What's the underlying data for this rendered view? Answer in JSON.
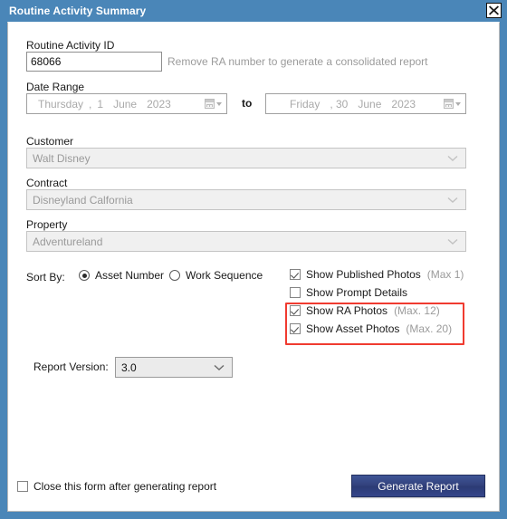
{
  "window": {
    "title": "Routine Activity Summary",
    "close_icon": "close-icon",
    "accent_color": "#4a86b8",
    "highlight_color": "#f03b30"
  },
  "form": {
    "ra_id": {
      "label": "Routine Activity ID",
      "value": "68066",
      "hint": "Remove RA number to generate a consolidated report"
    },
    "date_range": {
      "label": "Date Range",
      "separator": "to",
      "from": {
        "weekday": "Thursday",
        "comma": ",",
        "day": "1",
        "month": "June",
        "year": "2023"
      },
      "until": {
        "weekday": "Friday",
        "comma": ", 30",
        "day": "",
        "month": "June",
        "year": "2023"
      }
    },
    "customer": {
      "label": "Customer",
      "value": "Walt Disney"
    },
    "contract": {
      "label": "Contract",
      "value": "Disneyland Calfornia"
    },
    "property": {
      "label": "Property",
      "value": "Adventureland"
    },
    "sort_by": {
      "label": "Sort By:",
      "options": [
        {
          "label": "Asset Number",
          "selected": true
        },
        {
          "label": "Work Sequence",
          "selected": false
        }
      ]
    },
    "photo_options": [
      {
        "label": "Show Published Photos",
        "max": "(Max 1)",
        "checked": true
      },
      {
        "label": "Show Prompt Details",
        "max": "",
        "checked": false
      },
      {
        "label": "Show RA Photos",
        "max": "(Max. 12)",
        "checked": true
      },
      {
        "label": "Show Asset Photos",
        "max": "(Max. 20)",
        "checked": true
      }
    ],
    "report_version": {
      "label": "Report Version:",
      "value": "3.0"
    }
  },
  "footer": {
    "close_after": {
      "label": "Close this form after generating report",
      "checked": false
    },
    "generate_button": "Generate Report"
  }
}
